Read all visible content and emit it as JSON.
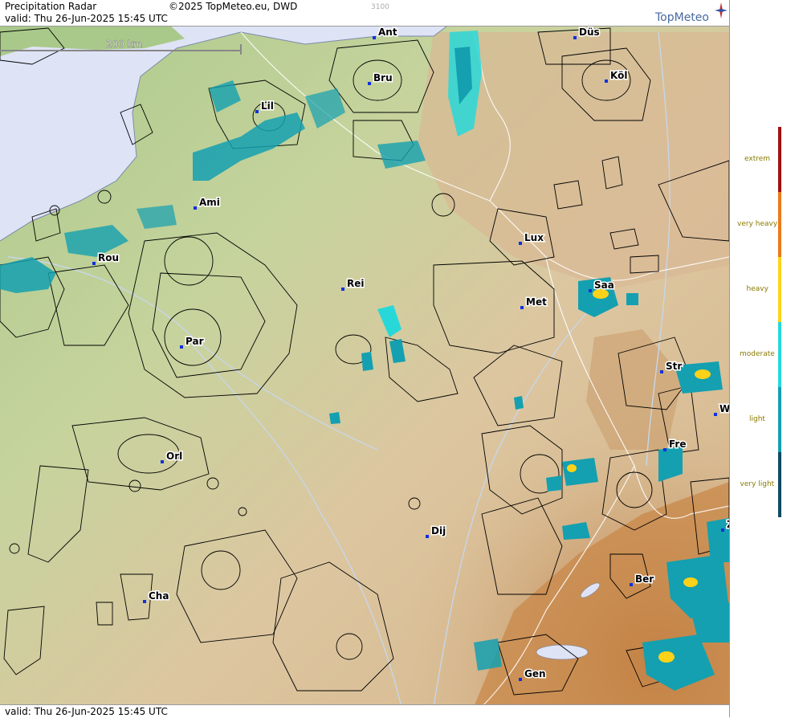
{
  "header": {
    "title": "Precipitation Radar",
    "copyright": "©2025 TopMeteo.eu, DWD",
    "code": "3100",
    "valid_top": "valid:  Thu  26-Jun-2025 15:45 UTC",
    "valid_bottom": "valid:  Thu  26-Jun-2025 15:45 UTC",
    "brand": "TopMeteo"
  },
  "scale": {
    "label": "200 km"
  },
  "cities": [
    {
      "code": "Ant"
    },
    {
      "code": "Düs"
    },
    {
      "code": "Bru"
    },
    {
      "code": "Köl"
    },
    {
      "code": "Lil"
    },
    {
      "code": "Ami"
    },
    {
      "code": "Lux"
    },
    {
      "code": "Rou"
    },
    {
      "code": "Saa"
    },
    {
      "code": "Rei"
    },
    {
      "code": "Met"
    },
    {
      "code": "Par"
    },
    {
      "code": "Str"
    },
    {
      "code": "W"
    },
    {
      "code": "Fre"
    },
    {
      "code": "Orl"
    },
    {
      "code": "Z"
    },
    {
      "code": "Dij"
    },
    {
      "code": "Ber"
    },
    {
      "code": "Cha"
    },
    {
      "code": "Gen"
    }
  ],
  "legend": {
    "levels": [
      {
        "label": "extrem",
        "color": "#a01010"
      },
      {
        "label": "very heavy",
        "color": "#ee7a1a"
      },
      {
        "label": "heavy",
        "color": "#ffd21a"
      },
      {
        "label": "moderate",
        "color": "#28d8d8"
      },
      {
        "label": "light",
        "color": "#14a0b0"
      },
      {
        "label": "very light",
        "color": "#104a60"
      }
    ]
  },
  "colors": {
    "sea": "#dfe3f6",
    "lowland": "#b7cf95",
    "hills": "#d9c09a",
    "mountains": "#c7874a",
    "radar_light": "#14a0b0",
    "radar_moderate": "#28d8d8",
    "radar_heavy": "#ffd21a"
  }
}
